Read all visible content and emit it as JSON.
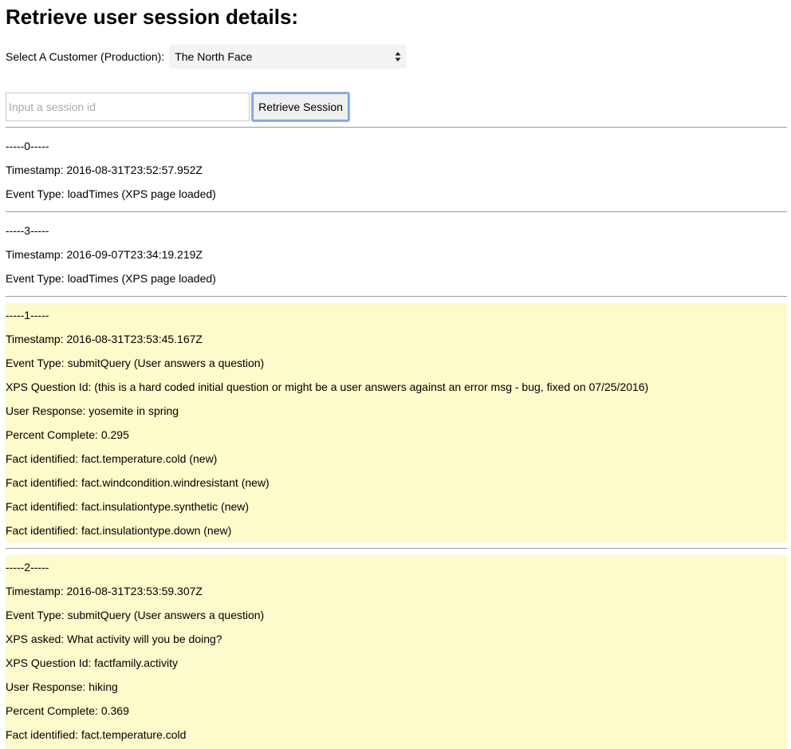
{
  "page": {
    "title": "Retrieve user session details:"
  },
  "customer": {
    "label": "Select A Customer (Production):",
    "selected": "The North Face"
  },
  "search": {
    "placeholder": "Input a session id",
    "value": "",
    "button_label": "Retrieve Session"
  },
  "events": [
    {
      "highlight": false,
      "lines": [
        "-----0-----",
        "Timestamp: 2016-08-31T23:52:57.952Z",
        "Event Type: loadTimes (XPS page loaded)"
      ]
    },
    {
      "highlight": false,
      "lines": [
        "-----3-----",
        "Timestamp: 2016-09-07T23:34:19.219Z",
        "Event Type: loadTimes (XPS page loaded)"
      ]
    },
    {
      "highlight": true,
      "lines": [
        "-----1-----",
        "Timestamp: 2016-08-31T23:53:45.167Z",
        "Event Type: submitQuery (User answers a question)",
        "XPS Question Id: (this is a hard coded initial question or might be a user answers against an error msg - bug, fixed on 07/25/2016)",
        "User Response: yosemite in spring",
        "Percent Complete: 0.295",
        "Fact identified: fact.temperature.cold (new)",
        "Fact identified: fact.windcondition.windresistant (new)",
        "Fact identified: fact.insulationtype.synthetic (new)",
        "Fact identified: fact.insulationtype.down (new)"
      ]
    },
    {
      "highlight": true,
      "lines": [
        "-----2-----",
        "Timestamp: 2016-08-31T23:53:59.307Z",
        "Event Type: submitQuery (User answers a question)",
        "XPS asked: What activity will you be doing?",
        "XPS Question Id: factfamily.activity",
        "User Response: hiking",
        "Percent Complete: 0.369",
        "Fact identified: fact.temperature.cold"
      ]
    }
  ]
}
